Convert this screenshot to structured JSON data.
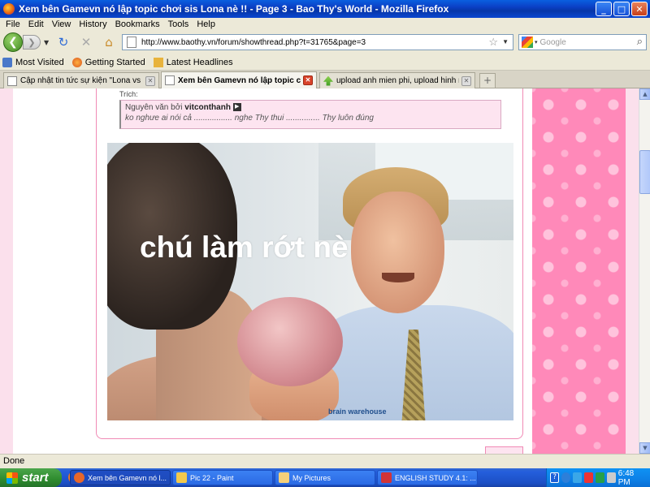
{
  "window": {
    "title": "Xem bên Gamevn nó lập topic chơi sis Lona nè !! - Page 3 - Bao Thy's World - Mozilla Firefox",
    "btn_min": "_",
    "btn_max": "□",
    "btn_close": "✕"
  },
  "menu": [
    "File",
    "Edit",
    "View",
    "History",
    "Bookmarks",
    "Tools",
    "Help"
  ],
  "nav": {
    "back_glyph": "❮",
    "forward_glyph": "❯",
    "url": "http://www.baothy.vn/forum/showthread.php?t=31765&page=3",
    "search_placeholder": "Google"
  },
  "bookmarks": [
    {
      "label": "Most Visited",
      "icon": "bookmarks-icon",
      "color": "#4a78c9"
    },
    {
      "label": "Getting Started",
      "icon": "firefox-icon",
      "color": "#d9541e"
    },
    {
      "label": "Latest Headlines",
      "icon": "rss-folder-icon",
      "color": "#e8b33c"
    }
  ],
  "tabs": [
    {
      "label": "Cập nhật tin tức sự kiện \"Lona vs Lenk...",
      "active": false
    },
    {
      "label": "Xem bên Gamevn nó lập topic ch...",
      "active": true
    },
    {
      "label": "upload anh mien phi, upload hinh mien ...",
      "active": false
    }
  ],
  "post": {
    "quote_label": "Trích:",
    "quote_prefix": "Nguyên văn bởi",
    "quote_author": "vitconthanh",
    "quote_text": "ko nghưe ai nói cả ................. nghe Thy thui ............... Thy luôn đúng",
    "image_caption": "chú làm rớt nè",
    "image_logo": "brain warehouse"
  },
  "status": "Done",
  "taskbar": {
    "start": "start",
    "tasks": [
      {
        "label": "Xem bên Gamevn nó l...",
        "active": true,
        "color": "#e8672a"
      },
      {
        "label": "Pic 22 - Paint",
        "active": false,
        "color": "#f2c94c"
      },
      {
        "label": "My Pictures",
        "active": false,
        "color": "#f5d07a"
      },
      {
        "label": "ENGLISH STUDY 4.1: ...",
        "active": false,
        "color": "#d13438"
      }
    ],
    "clock": "6:48 PM"
  },
  "colors": {
    "accent": "#0a46d0",
    "pink_background": "#ff89b9",
    "quote_background": "#fde4f0"
  }
}
